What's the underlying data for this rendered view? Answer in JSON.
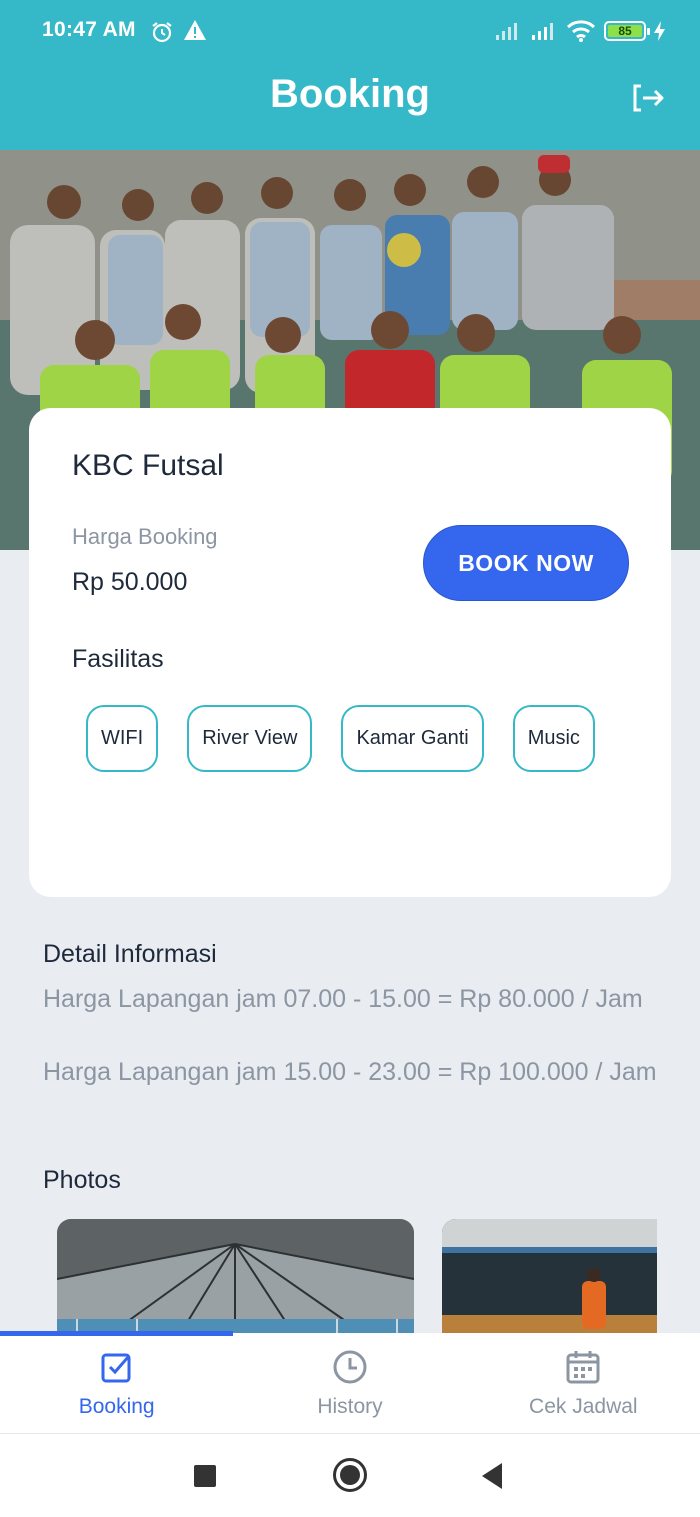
{
  "status_bar": {
    "time": "10:47 AM",
    "battery": "85"
  },
  "app_bar": {
    "title": "Booking",
    "logout_icon": "logout-icon"
  },
  "venue": {
    "name": "KBC Futsal",
    "price_label": "Harga Booking",
    "price": "Rp 50.000",
    "book_button": "BOOK NOW"
  },
  "facilities": {
    "title": "Fasilitas",
    "items": [
      "WIFI",
      "River View",
      "Kamar Ganti",
      "Music"
    ]
  },
  "detail": {
    "title": "Detail Informasi",
    "lines": [
      "Harga Lapangan jam 07.00 - 15.00 = Rp 80.000 / Jam",
      "Harga Lapangan jam 15.00 - 23.00 = Rp 100.000 / Jam"
    ]
  },
  "photos": {
    "title": "Photos"
  },
  "bottom_nav": {
    "items": [
      {
        "label": "Booking",
        "icon": "checkbox-icon",
        "active": true
      },
      {
        "label": "History",
        "icon": "clock-icon",
        "active": false
      },
      {
        "label": "Cek Jadwal",
        "icon": "calendar-icon",
        "active": false
      }
    ]
  },
  "colors": {
    "primary": "#35b8c7",
    "accent": "#3567ee",
    "background": "#e9ecf1",
    "muted_text": "#8c96a3"
  }
}
